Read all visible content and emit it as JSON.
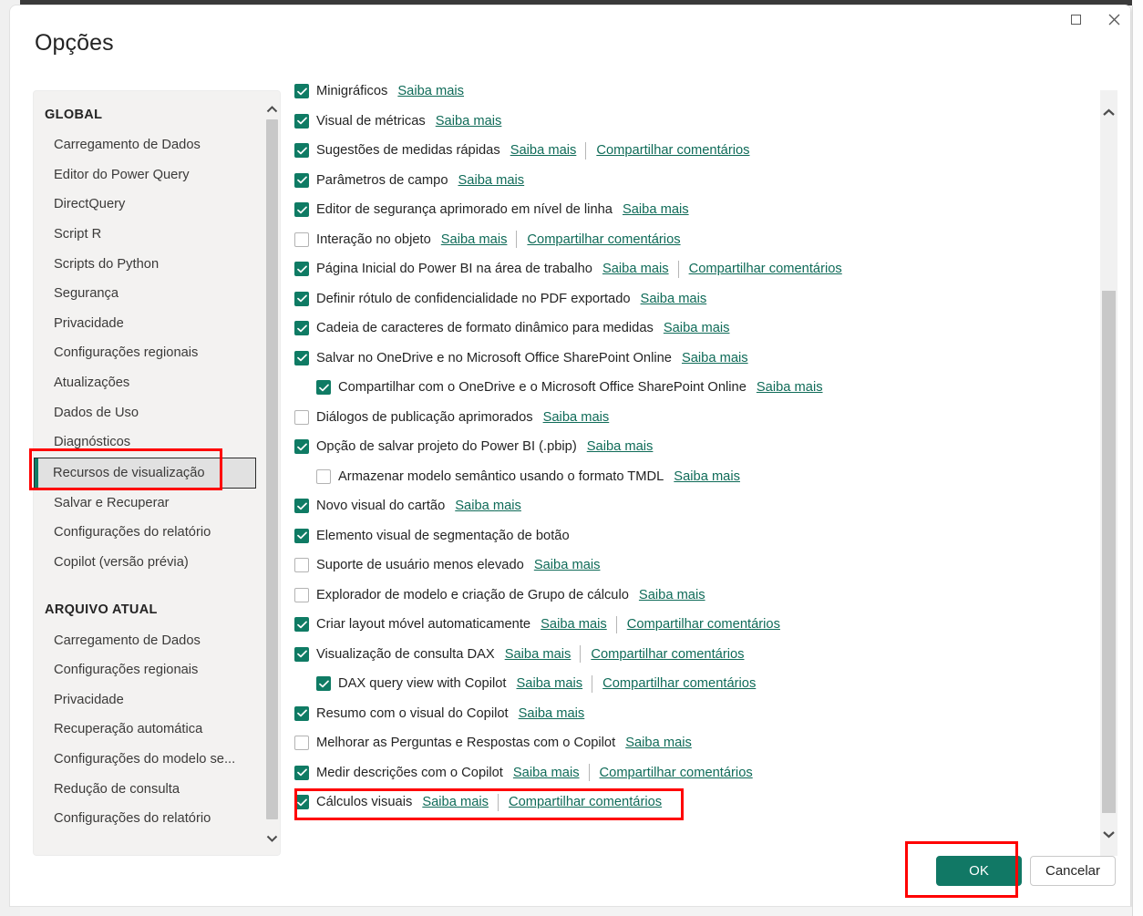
{
  "window": {
    "title": "Opções",
    "controls": [
      {
        "name": "maximize",
        "glyph": "square"
      },
      {
        "name": "close",
        "glyph": "x"
      }
    ]
  },
  "sidebar": {
    "groups": [
      {
        "header": "GLOBAL",
        "items": [
          {
            "label": "Carregamento de Dados",
            "selected": false
          },
          {
            "label": "Editor do Power Query",
            "selected": false
          },
          {
            "label": "DirectQuery",
            "selected": false
          },
          {
            "label": "Script R",
            "selected": false
          },
          {
            "label": "Scripts do Python",
            "selected": false
          },
          {
            "label": "Segurança",
            "selected": false
          },
          {
            "label": "Privacidade",
            "selected": false
          },
          {
            "label": "Configurações regionais",
            "selected": false
          },
          {
            "label": "Atualizações",
            "selected": false
          },
          {
            "label": "Dados de Uso",
            "selected": false
          },
          {
            "label": "Diagnósticos",
            "selected": false
          },
          {
            "label": "Recursos de visualização",
            "selected": true
          },
          {
            "label": "Salvar e Recuperar",
            "selected": false
          },
          {
            "label": "Configurações do relatório",
            "selected": false
          },
          {
            "label": "Copilot (versão prévia)",
            "selected": false
          }
        ]
      },
      {
        "header": "ARQUIVO ATUAL",
        "items": [
          {
            "label": "Carregamento de Dados",
            "selected": false
          },
          {
            "label": "Configurações regionais",
            "selected": false
          },
          {
            "label": "Privacidade",
            "selected": false
          },
          {
            "label": "Recuperação automática",
            "selected": false
          },
          {
            "label": "Configurações do modelo se...",
            "selected": false
          },
          {
            "label": "Redução de consulta",
            "selected": false
          },
          {
            "label": "Configurações do relatório",
            "selected": false
          }
        ]
      }
    ],
    "scrollbar": {
      "up_icon": "chevron-up-icon",
      "down_icon": "chevron-down-icon"
    }
  },
  "main": {
    "link_learn_more": "Saiba mais",
    "link_share_feedback": "Compartilhar comentários",
    "options": [
      {
        "label": "Minigráficos",
        "checked": true,
        "indent": false,
        "learn_more": true,
        "feedback": false
      },
      {
        "label": "Visual de métricas",
        "checked": true,
        "indent": false,
        "learn_more": true,
        "feedback": false
      },
      {
        "label": "Sugestões de medidas rápidas",
        "checked": true,
        "indent": false,
        "learn_more": true,
        "feedback": true
      },
      {
        "label": "Parâmetros de campo",
        "checked": true,
        "indent": false,
        "learn_more": true,
        "feedback": false
      },
      {
        "label": "Editor de segurança aprimorado em nível de linha",
        "checked": true,
        "indent": false,
        "learn_more": true,
        "feedback": false
      },
      {
        "label": "Interação no objeto",
        "checked": false,
        "indent": false,
        "learn_more": true,
        "feedback": true
      },
      {
        "label": "Página Inicial do Power BI na área de trabalho",
        "checked": true,
        "indent": false,
        "learn_more": true,
        "feedback": true
      },
      {
        "label": "Definir rótulo de confidencialidade no PDF exportado",
        "checked": true,
        "indent": false,
        "learn_more": true,
        "feedback": false
      },
      {
        "label": "Cadeia de caracteres de formato dinâmico para medidas",
        "checked": true,
        "indent": false,
        "learn_more": true,
        "feedback": false
      },
      {
        "label": "Salvar no OneDrive e no Microsoft Office SharePoint Online",
        "checked": true,
        "indent": false,
        "learn_more": true,
        "feedback": false
      },
      {
        "label": "Compartilhar com o OneDrive e o Microsoft Office SharePoint Online",
        "checked": true,
        "indent": true,
        "learn_more": true,
        "feedback": false
      },
      {
        "label": "Diálogos de publicação aprimorados",
        "checked": false,
        "indent": false,
        "learn_more": true,
        "feedback": false
      },
      {
        "label": "Opção de salvar projeto do Power BI (.pbip)",
        "checked": true,
        "indent": false,
        "learn_more": true,
        "feedback": false
      },
      {
        "label": "Armazenar modelo semântico usando o formato TMDL",
        "checked": false,
        "indent": true,
        "learn_more": true,
        "feedback": false
      },
      {
        "label": "Novo visual do cartão",
        "checked": true,
        "indent": false,
        "learn_more": true,
        "feedback": false
      },
      {
        "label": "Elemento visual de segmentação de botão",
        "checked": true,
        "indent": false,
        "learn_more": false,
        "feedback": false
      },
      {
        "label": "Suporte de usuário menos elevado",
        "checked": false,
        "indent": false,
        "learn_more": true,
        "feedback": false
      },
      {
        "label": "Explorador de modelo e criação de Grupo de cálculo",
        "checked": false,
        "indent": false,
        "learn_more": true,
        "feedback": false
      },
      {
        "label": "Criar layout móvel automaticamente",
        "checked": true,
        "indent": false,
        "learn_more": true,
        "feedback": true
      },
      {
        "label": "Visualização de consulta DAX",
        "checked": true,
        "indent": false,
        "learn_more": true,
        "feedback": true
      },
      {
        "label": "DAX query view with Copilot",
        "checked": true,
        "indent": true,
        "learn_more": true,
        "feedback": true
      },
      {
        "label": "Resumo com o visual do Copilot",
        "checked": true,
        "indent": false,
        "learn_more": true,
        "feedback": false
      },
      {
        "label": "Melhorar as Perguntas e Respostas com o Copilot",
        "checked": false,
        "indent": false,
        "learn_more": true,
        "feedback": false
      },
      {
        "label": "Medir descrições com o Copilot",
        "checked": true,
        "indent": false,
        "learn_more": true,
        "feedback": true
      },
      {
        "label": "Cálculos visuais",
        "checked": true,
        "indent": false,
        "learn_more": true,
        "feedback": true
      }
    ],
    "scrollbar": {
      "up_icon": "chevron-up-icon",
      "down_icon": "chevron-down-icon"
    }
  },
  "footer": {
    "ok_label": "OK",
    "cancel_label": "Cancelar"
  },
  "colors": {
    "accent_green": "#0f7b64",
    "ok_button": "#117865",
    "link": "#0f6b58",
    "annotation_red": "#ff0000",
    "sidebar_bg": "#f3f2f1",
    "selected_bg": "#e1e1e1"
  },
  "annotations": [
    {
      "name": "highlight-sidebar-visualization-features",
      "target": "Recursos de visualização"
    },
    {
      "name": "highlight-visual-calculations-row",
      "target": "Cálculos visuais"
    },
    {
      "name": "highlight-ok-button",
      "target": "OK"
    }
  ]
}
